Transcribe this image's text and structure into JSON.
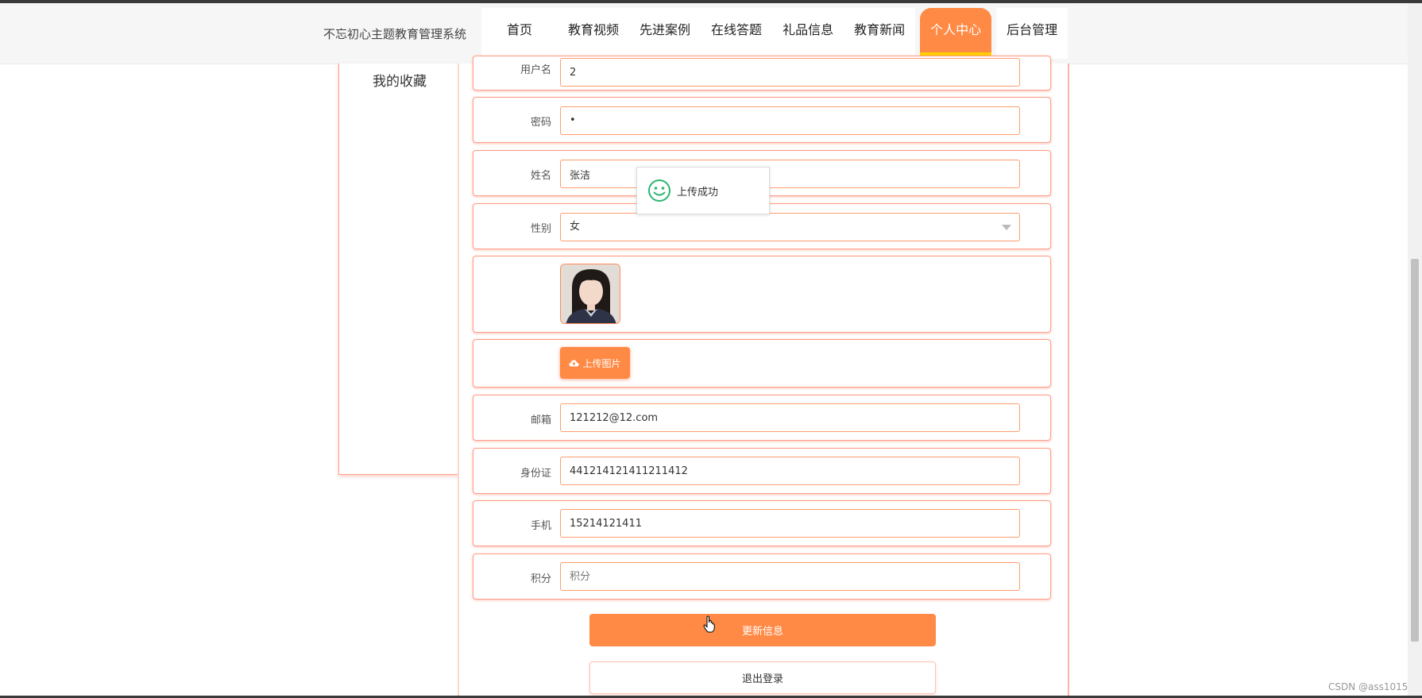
{
  "header": {
    "site_title": "不忘初心主题教育管理系统",
    "nav": [
      {
        "label": "首页"
      },
      {
        "label": "教育视频"
      },
      {
        "label": "先进案例"
      },
      {
        "label": "在线答题"
      },
      {
        "label": "礼品信息"
      },
      {
        "label": "教育新闻"
      },
      {
        "label": "个人中心",
        "active": true
      },
      {
        "label": "后台管理"
      }
    ]
  },
  "sidebar": {
    "favorites_label": "我的收藏"
  },
  "form": {
    "username": {
      "label": "用户名",
      "value": "2"
    },
    "password": {
      "label": "密码",
      "value": "•"
    },
    "name": {
      "label": "姓名",
      "value": "张洁"
    },
    "gender": {
      "label": "性别",
      "value": "女"
    },
    "upload_button": "上传图片",
    "email": {
      "label": "邮箱",
      "value": "121212@12.com"
    },
    "id_card": {
      "label": "身份证",
      "value": "441214121411211412"
    },
    "phone": {
      "label": "手机",
      "value": "15214121411"
    },
    "points": {
      "label": "积分",
      "placeholder": "积分"
    }
  },
  "toast": {
    "message": "上传成功"
  },
  "actions": {
    "update_label": "更新信息",
    "logout_label": "退出登录"
  },
  "watermark": "CSDN @ass1015",
  "colors": {
    "accent": "#ff8a45",
    "active_underline": "#ffd000",
    "success_icon": "#2bb673",
    "panel_border": "#ff9c85"
  }
}
